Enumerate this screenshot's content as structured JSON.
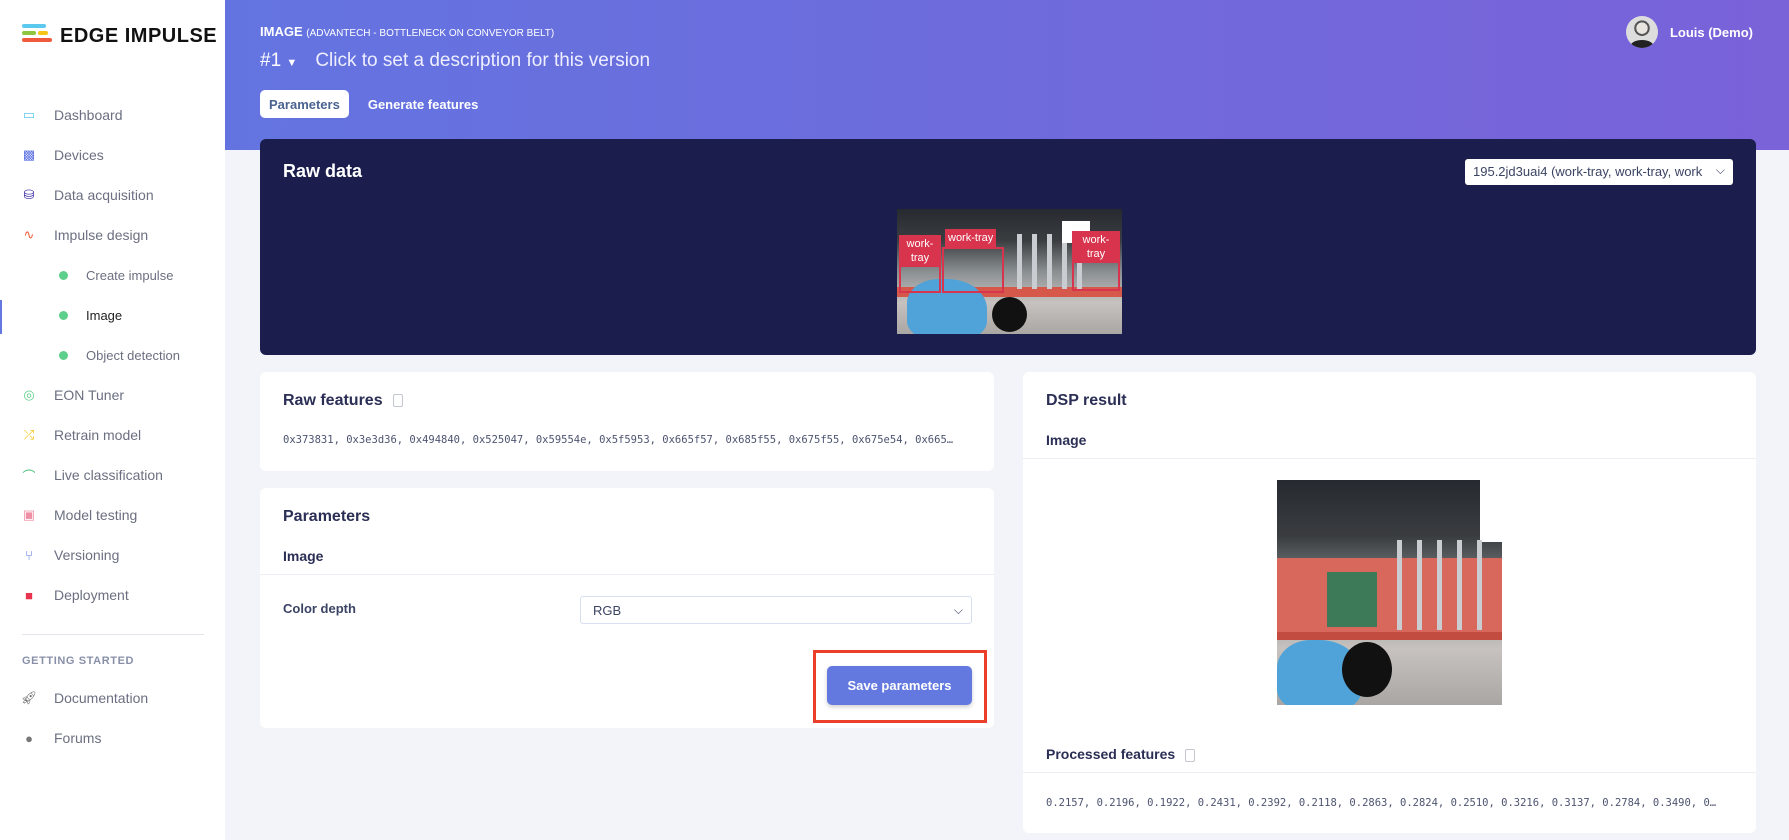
{
  "brand": {
    "name": "EDGE IMPULSE"
  },
  "sidebar": {
    "items": [
      {
        "label": "Dashboard",
        "icon": "monitor-icon",
        "color": "#5bc8ee"
      },
      {
        "label": "Devices",
        "icon": "chip-icon",
        "color": "#5a6fe0"
      },
      {
        "label": "Data acquisition",
        "icon": "database-icon",
        "color": "#3a2aa0"
      },
      {
        "label": "Impulse design",
        "icon": "pulse-icon",
        "color": "#f05a3c"
      },
      {
        "label": "Create impulse",
        "icon": "dot-icon",
        "color": "#5ccf8a"
      },
      {
        "label": "Image",
        "icon": "dot-icon",
        "color": "#5ccf8a",
        "active": true
      },
      {
        "label": "Object detection",
        "icon": "dot-icon",
        "color": "#5ccf8a"
      },
      {
        "label": "EON Tuner",
        "icon": "compass-icon",
        "color": "#5ccf8a"
      },
      {
        "label": "Retrain model",
        "icon": "shuffle-icon",
        "color": "#f5c518"
      },
      {
        "label": "Live classification",
        "icon": "bezier-icon",
        "color": "#4cc07a"
      },
      {
        "label": "Model testing",
        "icon": "clipboard-check-icon",
        "color": "#ee8fa6"
      },
      {
        "label": "Versioning",
        "icon": "branch-icon",
        "color": "#5a6fe0"
      },
      {
        "label": "Deployment",
        "icon": "cube-icon",
        "color": "#e8344e"
      }
    ],
    "section_heading": "GETTING STARTED",
    "getting_started": [
      {
        "label": "Documentation",
        "icon": "rocket-icon"
      },
      {
        "label": "Forums",
        "icon": "chat-icon"
      }
    ]
  },
  "header": {
    "title": "IMAGE",
    "subtitle": "(ADVANTECH - BOTTLENECK ON CONVEYOR BELT)",
    "version": "#1",
    "version_description": "Click to set a description for this version",
    "tabs": [
      {
        "label": "Parameters",
        "active": true
      },
      {
        "label": "Generate features"
      }
    ],
    "user": "Louis (Demo)"
  },
  "raw_data": {
    "title": "Raw data",
    "sample_select": "195.2jd3uai4 (work-tray, work-tray, work",
    "labels": [
      "work-tray",
      "work-tray",
      "work-tray"
    ]
  },
  "raw_features": {
    "title": "Raw features",
    "values": "0x373831, 0x3e3d36, 0x494840, 0x525047, 0x59554e, 0x5f5953, 0x665f57, 0x685f55, 0x675f55, 0x675e54, 0x665…"
  },
  "parameters": {
    "title": "Parameters",
    "section": "Image",
    "color_depth_label": "Color depth",
    "color_depth_value": "RGB",
    "save_label": "Save parameters",
    "highlight_color": "#ea3f28"
  },
  "dsp_result": {
    "title": "DSP result",
    "section": "Image",
    "processed_title": "Processed features",
    "processed_values": "0.2157, 0.2196, 0.1922, 0.2431, 0.2392, 0.2118, 0.2863, 0.2824, 0.2510, 0.3216, 0.3137, 0.2784, 0.3490, 0…"
  },
  "colors": {
    "accent": "#6479e0",
    "header_start": "#6374e0",
    "header_end": "#7a62d9",
    "raw_panel": "#1b1e4c"
  }
}
